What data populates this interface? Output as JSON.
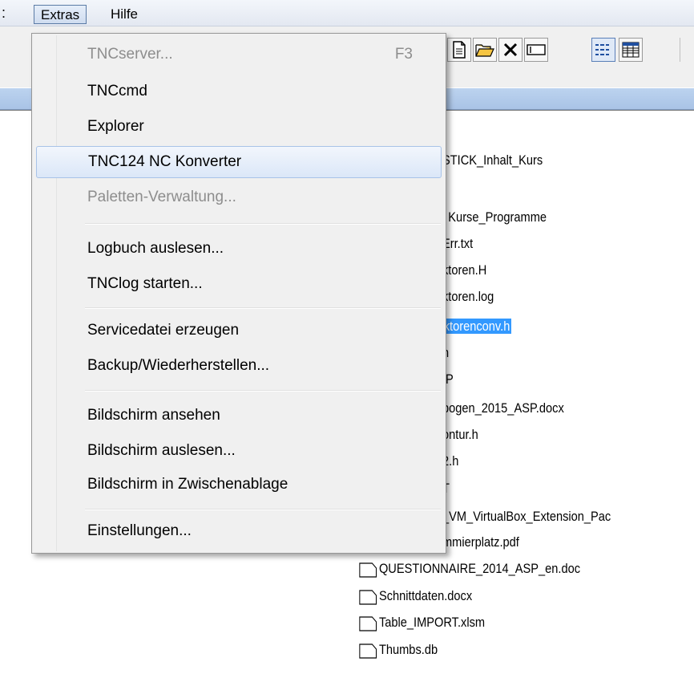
{
  "menubar": {
    "left_edge": ":",
    "extras_label": "Extras",
    "hilfe_label": "Hilfe"
  },
  "menu": {
    "items": [
      {
        "label": "TNCserver...",
        "shortcut": "F3",
        "disabled": true
      },
      {
        "label": "TNCcmd"
      },
      {
        "label": "Explorer"
      },
      {
        "label": "TNC124 NC Konverter",
        "highlighted": true
      },
      {
        "label": "Paletten-Verwaltung...",
        "disabled": true
      },
      {
        "label": "Logbuch auslesen..."
      },
      {
        "label": "TNClog starten..."
      },
      {
        "label": "Servicedatei erzeugen"
      },
      {
        "label": "Backup/Wiederherstellen..."
      },
      {
        "label": "Bildschirm ansehen"
      },
      {
        "label": "Bildschirm auslesen..."
      },
      {
        "label": "Bildschirm in Zwischenablage"
      },
      {
        "label": "Einstellungen..."
      }
    ]
  },
  "files": {
    "visible_partial": [
      "STICK_Inhalt_Kurs",
      "l Kurse_Programme",
      "Err.txt",
      "ktoren.H",
      "ktoren.log",
      "ktorenconv.h",
      "h",
      "IP",
      "bogen_2015_ASP.docx",
      "ontur.h",
      "2.h",
      "T",
      "_VM_VirtualBox_Extension_Pac",
      "mmierplatz.pdf"
    ],
    "full": [
      "QUESTIONNAIRE_2014_ASP_en.doc",
      "Schnittdaten.docx",
      "Table_IMPORT.xlsm",
      "Thumbs.db"
    ]
  },
  "colors": {
    "selection": "#3399ff",
    "menu_highlight_border": "#a8c3e8",
    "disabled_text": "#8d8d8d"
  }
}
